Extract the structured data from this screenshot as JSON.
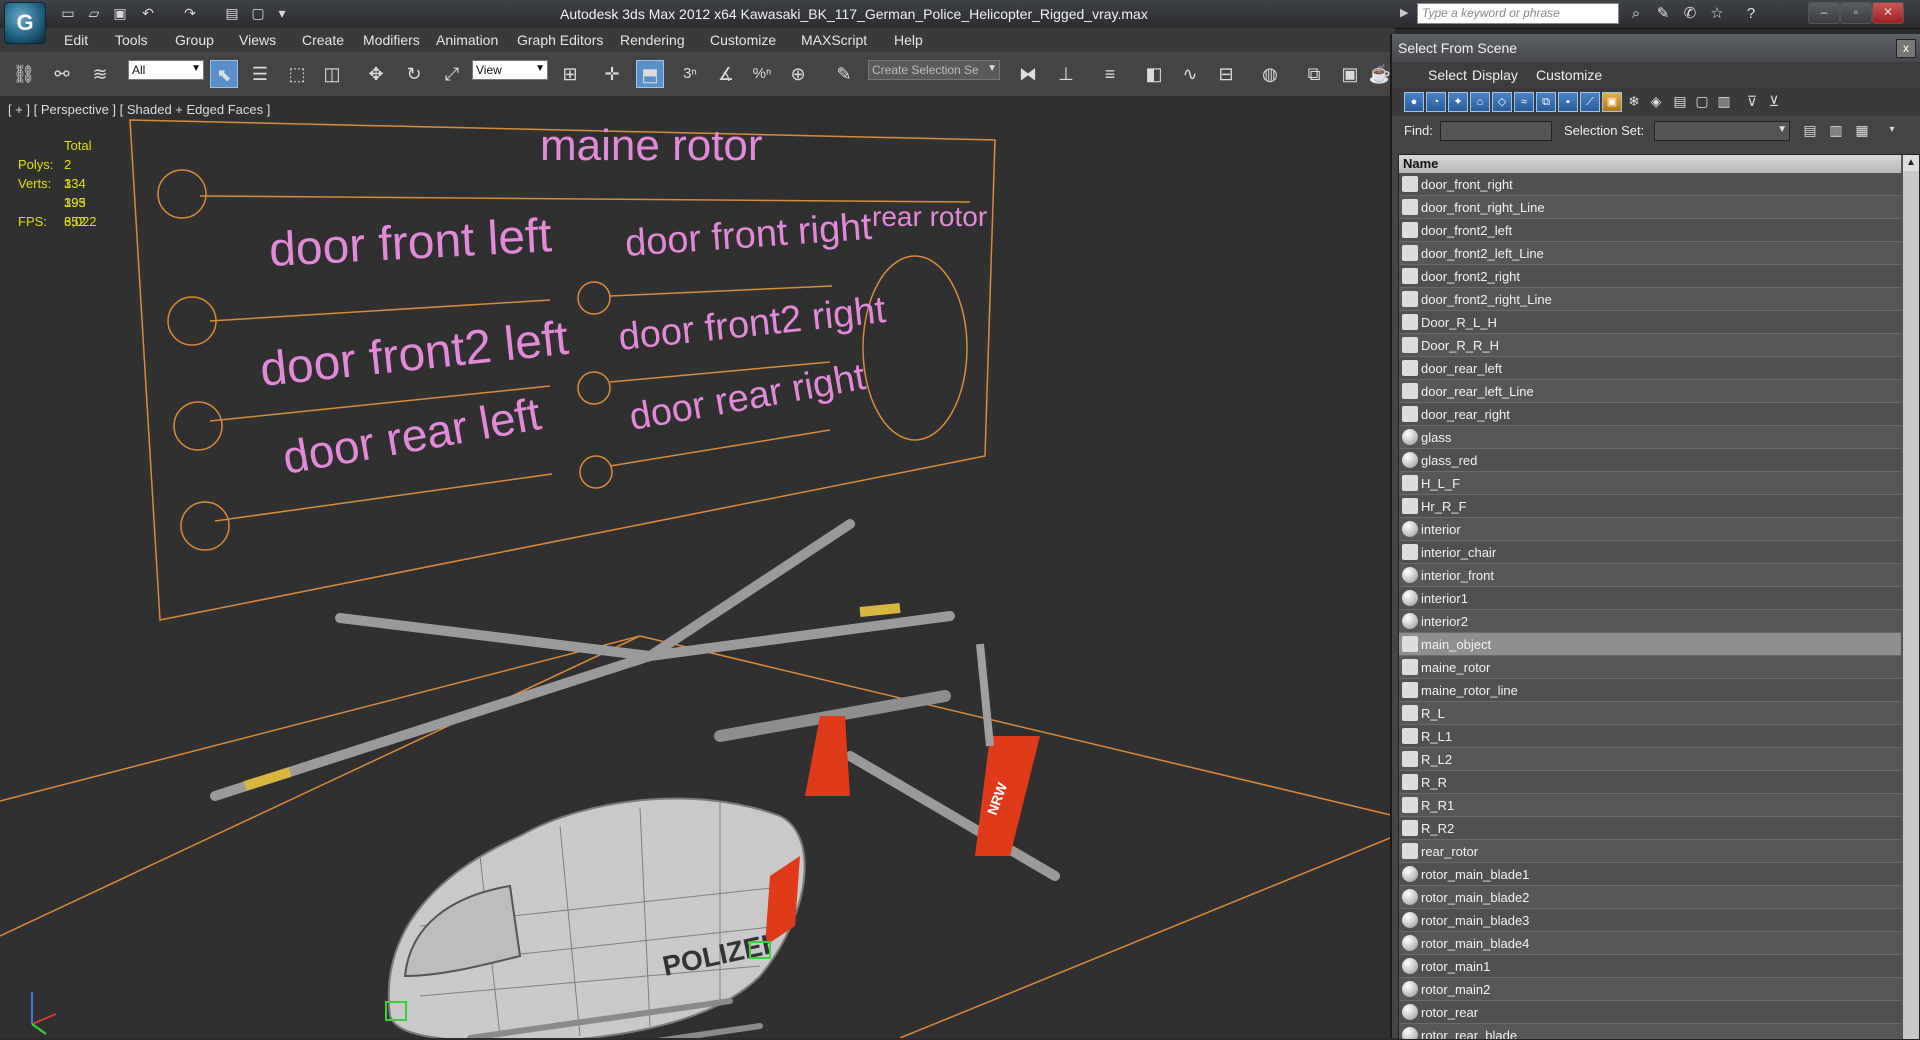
{
  "app": {
    "logo_letter": "G",
    "title": "Autodesk 3ds Max  2012 x64      Kawasaki_BK_117_German_Police_Helicopter_Rigged_vray.max",
    "search_placeholder": "Type a keyword or phrase"
  },
  "menu": {
    "items": [
      "Edit",
      "Tools",
      "Group",
      "Views",
      "Create",
      "Modifiers",
      "Animation",
      "Graph Editors",
      "Rendering",
      "Customize",
      "MAXScript",
      "Help"
    ]
  },
  "toolbar": {
    "filter_value": "All",
    "coord_value": "View",
    "selection_set_placeholder": "Create Selection Se",
    "snap_label": "3",
    "percent_label": "%"
  },
  "viewport": {
    "label": "[ + ] [ Perspective ] [ Shaded + Edged Faces ]",
    "stats": {
      "total_label": "Total",
      "polys_label": "Polys:",
      "polys_value": "2 334 393",
      "verts_label": "Verts:",
      "verts_value": "1 195 652",
      "fps_label": "FPS:",
      "fps_value": "3,022"
    },
    "panel_labels": {
      "main": "maine rotor",
      "front_left": "door front left",
      "front_right": "door front right",
      "rear_rotor": "rear rotor",
      "front2_left": "door front2 left",
      "front2_right": "door front2 right",
      "rear_left": "door rear left",
      "rear_right": "door rear right"
    },
    "heli_text": "POLIZEI",
    "tail_text": "NRW"
  },
  "scene_dialog": {
    "title": "Select From Scene",
    "close": "x",
    "menu": [
      "Select",
      "Display",
      "Customize"
    ],
    "find_label": "Find:",
    "selection_set_label": "Selection Set:",
    "column_header": "Name",
    "items": [
      {
        "name": "door_front_right",
        "kind": "helper"
      },
      {
        "name": "door_front_right_Line",
        "kind": "helper"
      },
      {
        "name": "door_front2_left",
        "kind": "helper"
      },
      {
        "name": "door_front2_left_Line",
        "kind": "helper"
      },
      {
        "name": "door_front2_right",
        "kind": "helper"
      },
      {
        "name": "door_front2_right_Line",
        "kind": "helper"
      },
      {
        "name": "Door_R_L_H",
        "kind": "helper"
      },
      {
        "name": "Door_R_R_H",
        "kind": "helper"
      },
      {
        "name": "door_rear_left",
        "kind": "helper"
      },
      {
        "name": "door_rear_left_Line",
        "kind": "helper"
      },
      {
        "name": "door_rear_right",
        "kind": "helper"
      },
      {
        "name": "glass",
        "kind": "geometry"
      },
      {
        "name": "glass_red",
        "kind": "geometry"
      },
      {
        "name": "H_L_F",
        "kind": "helper"
      },
      {
        "name": "Hr_R_F",
        "kind": "helper"
      },
      {
        "name": "interior",
        "kind": "geometry"
      },
      {
        "name": "interior_chair",
        "kind": "helper"
      },
      {
        "name": "interior_front",
        "kind": "geometry"
      },
      {
        "name": "interior1",
        "kind": "geometry"
      },
      {
        "name": "interior2",
        "kind": "geometry"
      },
      {
        "name": "main_object",
        "kind": "helper",
        "selected": true
      },
      {
        "name": "maine_rotor",
        "kind": "helper"
      },
      {
        "name": "maine_rotor_line",
        "kind": "helper"
      },
      {
        "name": "R_L",
        "kind": "helper"
      },
      {
        "name": "R_L1",
        "kind": "helper"
      },
      {
        "name": "R_L2",
        "kind": "helper"
      },
      {
        "name": "R_R",
        "kind": "helper"
      },
      {
        "name": "R_R1",
        "kind": "helper"
      },
      {
        "name": "R_R2",
        "kind": "helper"
      },
      {
        "name": "rear_rotor",
        "kind": "helper"
      },
      {
        "name": "rotor_main_blade1",
        "kind": "geometry"
      },
      {
        "name": "rotor_main_blade2",
        "kind": "geometry"
      },
      {
        "name": "rotor_main_blade3",
        "kind": "geometry"
      },
      {
        "name": "rotor_main_blade4",
        "kind": "geometry"
      },
      {
        "name": "rotor_main1",
        "kind": "geometry"
      },
      {
        "name": "rotor_main2",
        "kind": "geometry"
      },
      {
        "name": "rotor_rear",
        "kind": "geometry"
      },
      {
        "name": "rotor_rear_blade",
        "kind": "geometry"
      }
    ]
  },
  "colors": {
    "grid_line": "#d98a3a",
    "label_pink": "#e28ad7",
    "stats_yellow": "#e0e000",
    "selection_blue": "#5b8fc7",
    "heli_red": "#e03a1a"
  }
}
